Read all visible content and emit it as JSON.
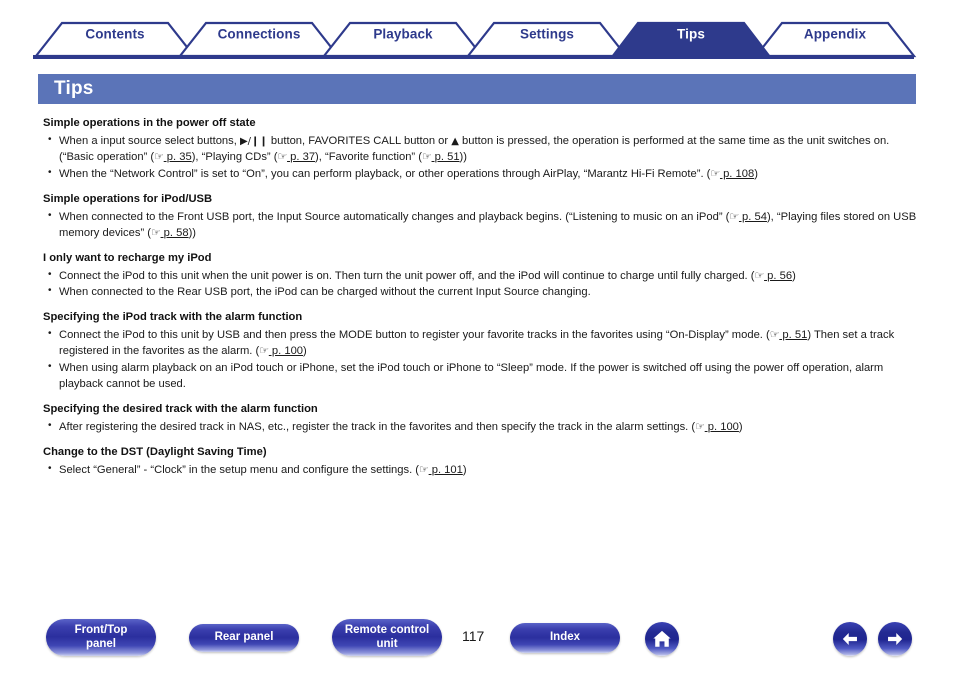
{
  "tabs": [
    {
      "label": "Contents",
      "active": false
    },
    {
      "label": "Connections",
      "active": false
    },
    {
      "label": "Playback",
      "active": false
    },
    {
      "label": "Settings",
      "active": false
    },
    {
      "label": "Tips",
      "active": true
    },
    {
      "label": "Appendix",
      "active": false
    }
  ],
  "page_title": "Tips",
  "colors": {
    "tab_border": "#2e3a8c",
    "tab_active_fill": "#2e3a8c",
    "banner_fill": "#5b74b8",
    "text": "#1a1a1a"
  },
  "sections": [
    {
      "heading": "Simple operations in the power off state",
      "bullets": [
        {
          "parts": [
            {
              "t": "text",
              "v": "When a input source select buttons, "
            },
            {
              "t": "glyph",
              "v": "▶/❙❙"
            },
            {
              "t": "text",
              "v": " button, FAVORITES CALL button or "
            },
            {
              "t": "glyph",
              "v": "▲"
            },
            {
              "t": "text",
              "v": " button is pressed, the operation is performed at the same time as the unit switches on. (“Basic operation” ("
            },
            {
              "t": "pref",
              "v": "p. 35"
            },
            {
              "t": "text",
              "v": "), “Playing CDs” ("
            },
            {
              "t": "pref",
              "v": "p. 37"
            },
            {
              "t": "text",
              "v": "), “Favorite function” ("
            },
            {
              "t": "pref",
              "v": "p. 51"
            },
            {
              "t": "text",
              "v": "))"
            }
          ]
        },
        {
          "parts": [
            {
              "t": "text",
              "v": "When the “Network Control” is set to “On”, you can perform playback, or other operations through AirPlay, “Marantz Hi-Fi Remote”.  ("
            },
            {
              "t": "pref",
              "v": "p. 108"
            },
            {
              "t": "text",
              "v": ")"
            }
          ]
        }
      ]
    },
    {
      "heading": "Simple operations for iPod/USB",
      "bullets": [
        {
          "parts": [
            {
              "t": "text",
              "v": "When connected to the Front USB port, the Input Source automatically changes and playback begins. (“Listening to music on an iPod” ("
            },
            {
              "t": "pref",
              "v": "p. 54"
            },
            {
              "t": "text",
              "v": "), “Playing files stored on USB memory devices” ("
            },
            {
              "t": "pref",
              "v": "p. 58"
            },
            {
              "t": "text",
              "v": "))"
            }
          ]
        }
      ]
    },
    {
      "heading": "I only want to recharge my iPod",
      "bullets": [
        {
          "parts": [
            {
              "t": "text",
              "v": "Connect the iPod to this unit when the unit power is on. Then turn the unit power off, and the iPod will continue to charge until fully charged.  ("
            },
            {
              "t": "pref",
              "v": "p. 56"
            },
            {
              "t": "text",
              "v": ")"
            }
          ]
        },
        {
          "parts": [
            {
              "t": "text",
              "v": "When connected to the Rear USB port, the iPod can be charged without the current Input Source changing."
            }
          ]
        }
      ]
    },
    {
      "heading": "Specifying the iPod track with the alarm function",
      "bullets": [
        {
          "parts": [
            {
              "t": "text",
              "v": "Connect the iPod to this unit by USB and then press the MODE button to register your favorite tracks in the favorites using “On-Display” mode. ("
            },
            {
              "t": "pref",
              "v": "p. 51"
            },
            {
              "t": "text",
              "v": ") Then set a track registered in the favorites as the alarm. ("
            },
            {
              "t": "pref",
              "v": "p. 100"
            },
            {
              "t": "text",
              "v": ")"
            }
          ]
        },
        {
          "parts": [
            {
              "t": "text",
              "v": "When using alarm playback on an iPod touch or iPhone, set the iPod touch or iPhone to “Sleep” mode. If the power is switched off using the power off operation, alarm playback cannot be used."
            }
          ]
        }
      ]
    },
    {
      "heading": "Specifying the desired track with the alarm function",
      "bullets": [
        {
          "parts": [
            {
              "t": "text",
              "v": "After registering the desired track in NAS, etc., register the track in the favorites and then specify the track in the alarm settings.  ("
            },
            {
              "t": "pref",
              "v": "p. 100"
            },
            {
              "t": "text",
              "v": ")"
            }
          ]
        }
      ]
    },
    {
      "heading": "Change to the DST (Daylight Saving Time)",
      "bullets": [
        {
          "parts": [
            {
              "t": "text",
              "v": "Select “General” - “Clock” in the setup menu and configure the settings.  ("
            },
            {
              "t": "pref",
              "v": "p. 101"
            },
            {
              "t": "text",
              "v": ")"
            }
          ]
        }
      ]
    }
  ],
  "footer": {
    "buttons": [
      {
        "name": "front-top-panel",
        "label": "Front/Top\npanel"
      },
      {
        "name": "rear-panel",
        "label": "Rear panel"
      },
      {
        "name": "remote-control-unit",
        "label": "Remote control\nunit"
      },
      {
        "name": "index",
        "label": "Index"
      }
    ],
    "page_number": "117",
    "icons": [
      {
        "name": "home-icon"
      },
      {
        "name": "arrow-left-icon"
      },
      {
        "name": "arrow-right-icon"
      }
    ]
  }
}
